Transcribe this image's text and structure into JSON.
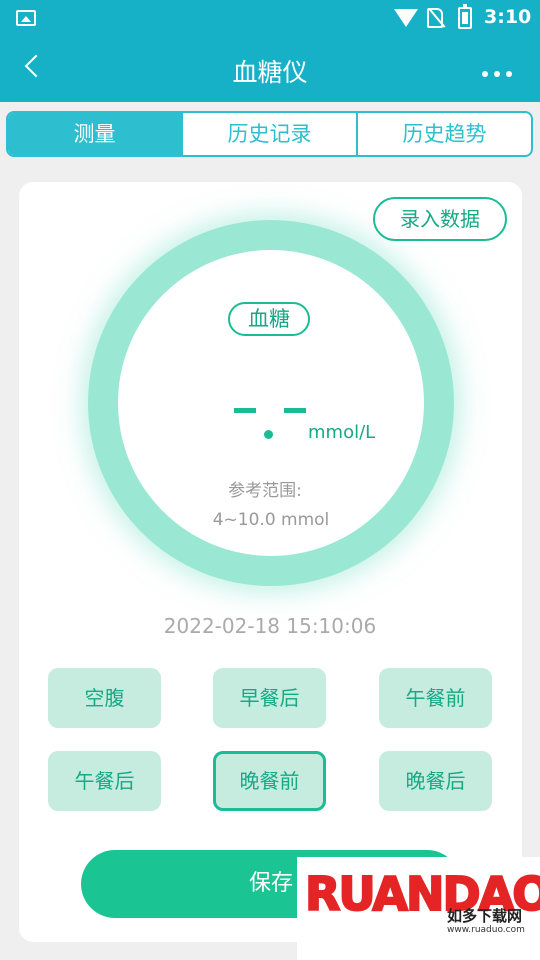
{
  "status_bar": {
    "time": "3:10"
  },
  "header": {
    "title": "血糖仪"
  },
  "tabs": [
    {
      "label": "测量",
      "active": true
    },
    {
      "label": "历史记录",
      "active": false
    },
    {
      "label": "历史趋势",
      "active": false
    }
  ],
  "record_button": "录入数据",
  "gauge": {
    "label": "血糖",
    "unit": "mmol/L",
    "reference_label": "参考范围:",
    "reference_value": "4~10.0 mmol"
  },
  "datetime": "2022-02-18 15:10:06",
  "meal_times": [
    {
      "label": "空腹",
      "selected": false
    },
    {
      "label": "早餐后",
      "selected": false
    },
    {
      "label": "午餐前",
      "selected": false
    },
    {
      "label": "午餐后",
      "selected": false
    },
    {
      "label": "晚餐前",
      "selected": true
    },
    {
      "label": "晚餐后",
      "selected": false
    }
  ],
  "save_button": "保存",
  "watermark": {
    "logo": "RUANDAO",
    "name": "如多下载网",
    "url": "www.ruaduo.com"
  },
  "colors": {
    "primary": "#16b1c6",
    "accent": "#1bbc93",
    "ring": "#9ae8d3",
    "meal_bg": "#c6ecdf"
  }
}
